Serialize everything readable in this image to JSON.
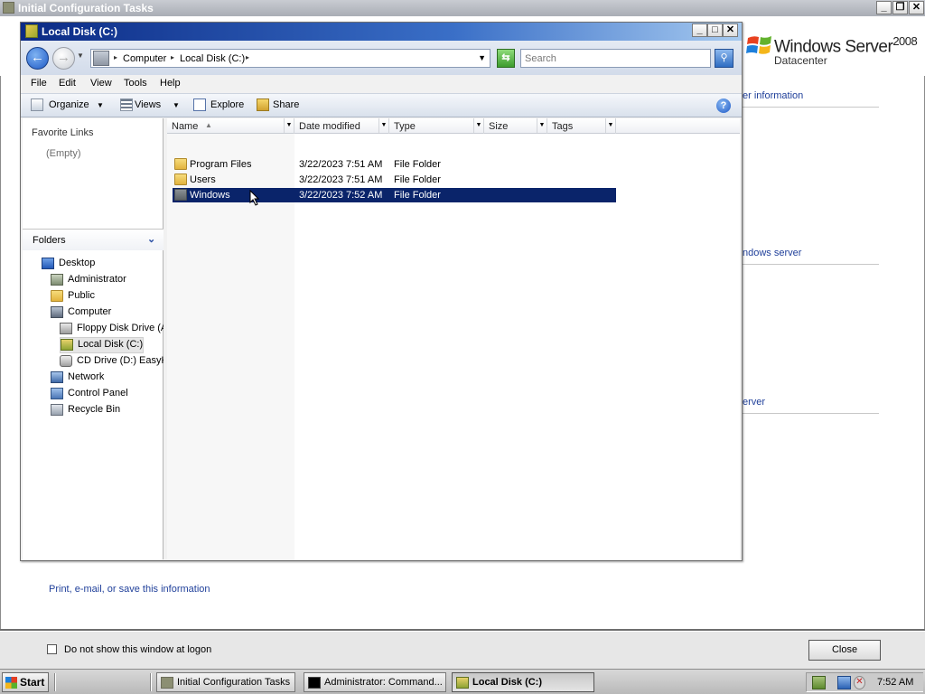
{
  "background_window": {
    "title": "Initial Configuration Tasks",
    "logo": {
      "name": "Windows Server",
      "version": "2008",
      "edition": "Datacenter"
    },
    "section_links": [
      "er information",
      "ndows server",
      "erver"
    ],
    "print_link": "Print, e-mail, or save this information",
    "no_show_label": "Do not show this window at logon",
    "no_show_checked": false,
    "close_button": "Close"
  },
  "explorer": {
    "title": "Local Disk (C:)",
    "address": {
      "crumbs": [
        "Computer",
        "Local Disk (C:)"
      ]
    },
    "search_placeholder": "Search",
    "menu": [
      "File",
      "Edit",
      "View",
      "Tools",
      "Help"
    ],
    "toolbar": {
      "organize": "Organize",
      "views": "Views",
      "explore": "Explore",
      "share": "Share"
    },
    "nav": {
      "favorite_links_title": "Favorite Links",
      "favorite_links_empty": "(Empty)",
      "folders_title": "Folders",
      "tree": [
        {
          "label": "Desktop",
          "icon": "desktop-icon"
        },
        {
          "label": "Administrator",
          "icon": "user-folder-icon"
        },
        {
          "label": "Public",
          "icon": "folder-icon"
        },
        {
          "label": "Computer",
          "icon": "computer-icon"
        },
        {
          "label": "Floppy Disk Drive (A",
          "icon": "floppy-drive-icon"
        },
        {
          "label": "Local Disk (C:)",
          "icon": "local-disk-icon",
          "selected": true
        },
        {
          "label": "CD Drive (D:) EasyK",
          "icon": "cd-drive-icon"
        },
        {
          "label": "Network",
          "icon": "network-icon"
        },
        {
          "label": "Control Panel",
          "icon": "control-panel-icon"
        },
        {
          "label": "Recycle Bin",
          "icon": "recycle-bin-icon"
        }
      ]
    },
    "columns": [
      "Name",
      "Date modified",
      "Type",
      "Size",
      "Tags"
    ],
    "files": [
      {
        "name": "Program Files",
        "date": "3/22/2023 7:51 AM",
        "type": "File Folder"
      },
      {
        "name": "Users",
        "date": "3/22/2023 7:51 AM",
        "type": "File Folder"
      },
      {
        "name": "Windows",
        "date": "3/22/2023 7:52 AM",
        "type": "File Folder",
        "selected": true
      }
    ]
  },
  "taskbar": {
    "start": "Start",
    "tasks": [
      {
        "label": "Initial Configuration Tasks",
        "icon": "config-tasks-icon"
      },
      {
        "label": "Administrator: Command...",
        "icon": "command-prompt-icon"
      },
      {
        "label": "Local Disk (C:)",
        "icon": "local-disk-icon",
        "active": true
      }
    ],
    "clock": "7:52 AM"
  },
  "colors": {
    "selection": "#0a246a",
    "title_gradient_start": "#0b2a85",
    "link": "#1f3f9a"
  }
}
